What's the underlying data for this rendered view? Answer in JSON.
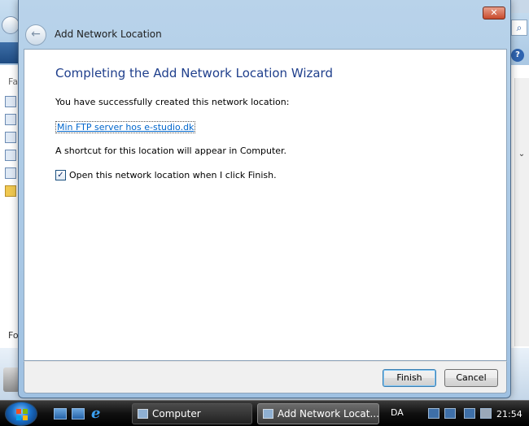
{
  "background_window": {
    "left_label_top": "Fa",
    "left_label_bottom": "Fo"
  },
  "dialog": {
    "title": "Add Network Location",
    "close_glyph": "✕",
    "back_glyph": "←",
    "heading": "Completing the Add Network Location Wizard",
    "success_text": "You have successfully created this network location:",
    "location_link": "Min FTP server hos e-studio.dk",
    "shortcut_text": "A shortcut for this location will appear in Computer.",
    "open_checkbox": {
      "checked": true,
      "label": "Open this network location when I click Finish."
    },
    "buttons": {
      "finish": "Finish",
      "cancel": "Cancel"
    }
  },
  "taskbar": {
    "tasks": [
      {
        "label": "Computer",
        "active": false
      },
      {
        "label": "Add Network Locat...",
        "active": true
      }
    ],
    "language": "DA",
    "clock": "21:54",
    "quick_launch": [
      "show-desktop-icon",
      "switch-windows-icon",
      "internet-explorer-icon"
    ]
  },
  "colors": {
    "heading": "#1f3f8c",
    "link": "#0066cc",
    "close_button": "#c84a2c",
    "dialog_frame": "#b9d3ea"
  }
}
